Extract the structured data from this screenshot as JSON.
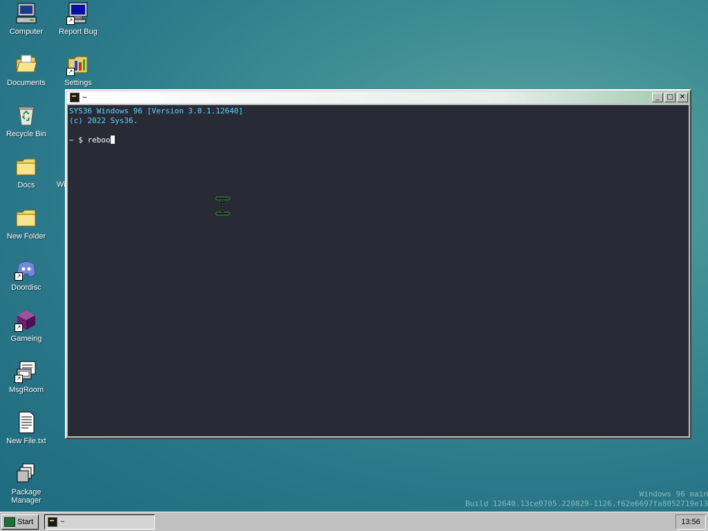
{
  "desktop": {
    "icons": [
      {
        "label": "Computer",
        "icon": "computer-icon",
        "shortcut": false
      },
      {
        "label": "Report Bug",
        "icon": "monitor-icon",
        "shortcut": true
      },
      {
        "label": "Documents",
        "icon": "folder-open-icon",
        "shortcut": false
      },
      {
        "label": "Settings",
        "icon": "settings-icon",
        "shortcut": true
      },
      {
        "label": "Recycle Bin",
        "icon": "recycle-bin-icon",
        "shortcut": false
      },
      {
        "label": "Docs",
        "icon": "folder-icon",
        "shortcut": false
      },
      {
        "label": "New Folder",
        "icon": "folder-icon",
        "shortcut": false
      },
      {
        "label": "Doordisc",
        "icon": "discord-icon",
        "shortcut": true
      },
      {
        "label": "Gameing",
        "icon": "cube-icon",
        "shortcut": true
      },
      {
        "label": "MsgRoom",
        "icon": "msgroom-icon",
        "shortcut": true
      },
      {
        "label": "New File.txt",
        "icon": "text-file-icon",
        "shortcut": false
      },
      {
        "label": "Package Manager",
        "icon": "package-icon",
        "shortcut": false
      }
    ],
    "partial_label": "Wi",
    "build_line1": "Windows 96 main",
    "build_line2": "Build 12640.13ce0705.220829-1126.f62e6697fa8052719e13"
  },
  "terminal": {
    "title": "~",
    "line1": "SYS36 Windows 96 [Version 3.0.1.12640]",
    "line2": "(c) 2022 Sys36.",
    "prompt": "~ $ ",
    "input": "reboo",
    "minimize_label": "_",
    "maximize_label": "□",
    "close_label": "✕"
  },
  "taskbar": {
    "start_label": "Start",
    "task_label": "~",
    "clock": "13:56"
  },
  "colors": {
    "terminal_bg": "#282a36",
    "terminal_text_cyan": "#5fd7ff",
    "taskbar": "#c0c0c0"
  }
}
